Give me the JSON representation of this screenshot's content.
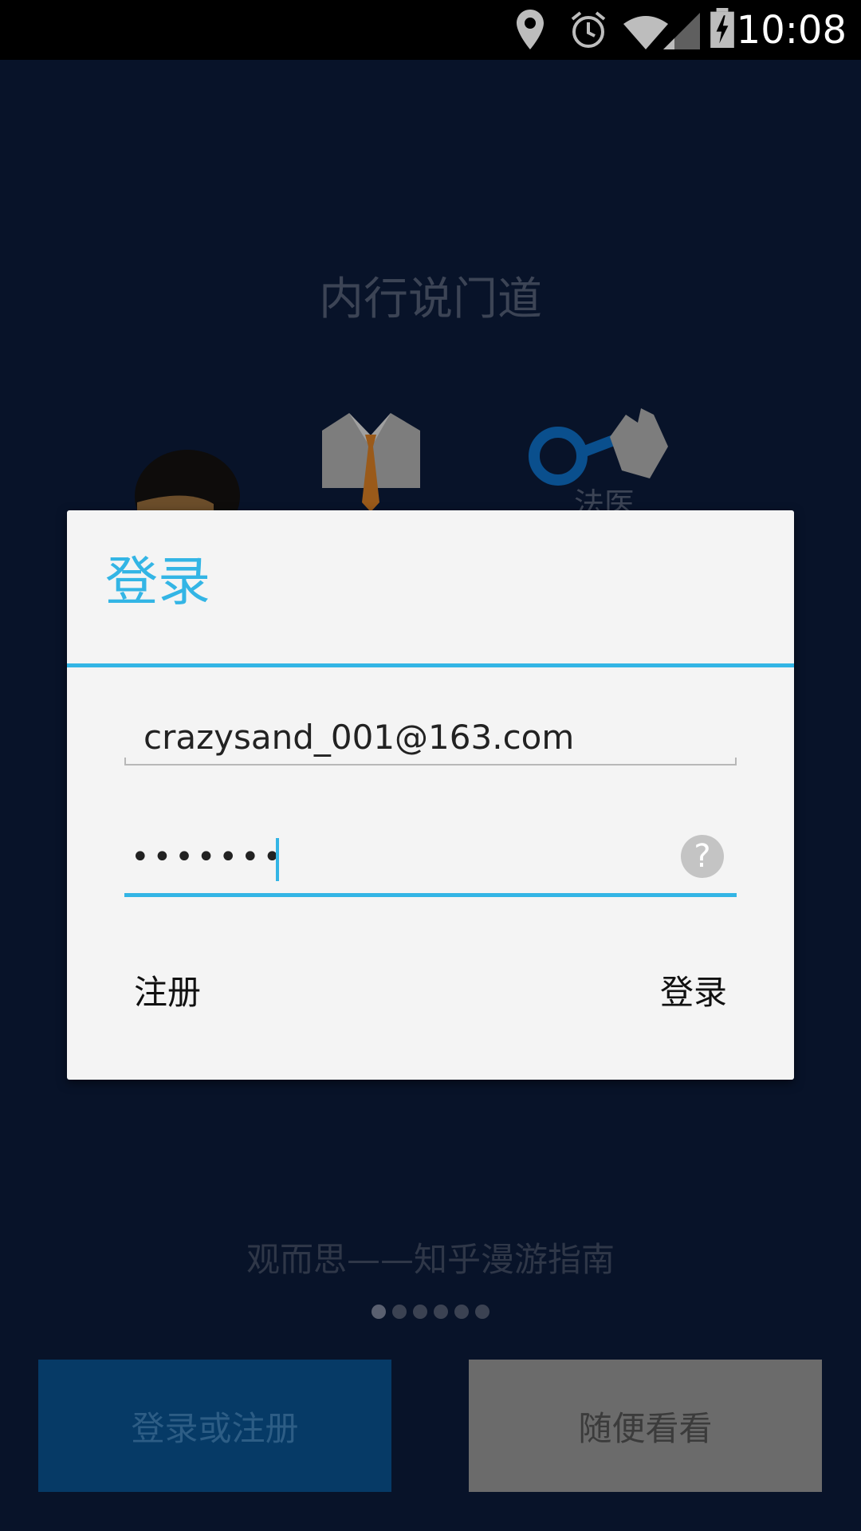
{
  "status_bar": {
    "time": "10:08",
    "icons": [
      "location-icon",
      "alarm-icon",
      "wifi-icon",
      "signal-icon",
      "battery-charging-icon"
    ]
  },
  "background": {
    "headline": "内行说门道",
    "illustration_label": "法医",
    "subtitle": "观而思——知乎漫游指南",
    "page_dots": 6,
    "active_dot": 0,
    "buttons": {
      "login_or_register": "登录或注册",
      "browse": "随便看看"
    }
  },
  "dialog": {
    "title": "登录",
    "email_value": "crazysand_001@163.com",
    "password_value": "•••••••",
    "help_icon": "help-icon",
    "register_label": "注册",
    "login_label": "登录"
  },
  "colors": {
    "accent": "#33b5e5",
    "background": "#081329",
    "login_button": "#063a66",
    "browse_button": "#6b6b6b"
  }
}
